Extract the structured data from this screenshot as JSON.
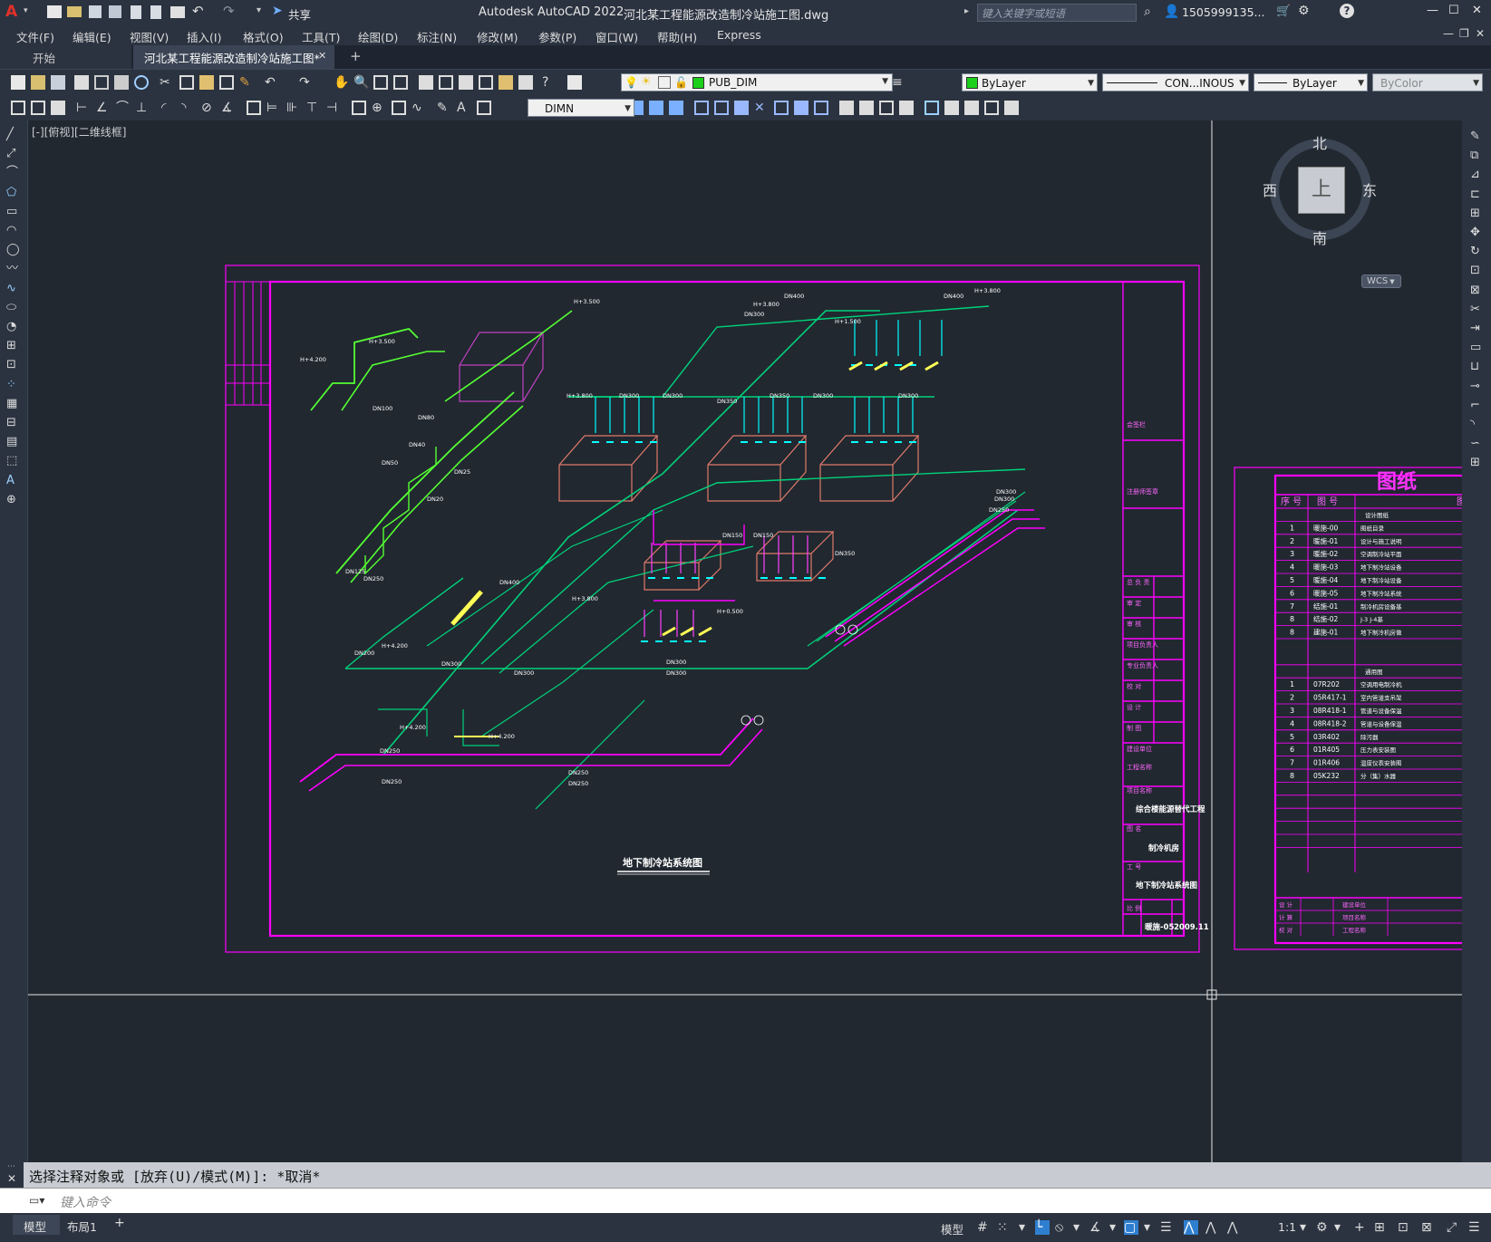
{
  "titlebar": {
    "app_title": "Autodesk AutoCAD 2022",
    "file_name": "河北某工程能源改造制冷站施工图.dwg",
    "share_label": "共享",
    "search_placeholder": "键入关键字或短语",
    "user": "1505999135...",
    "min": "—",
    "max": "☐",
    "close": "✕"
  },
  "menu": [
    "文件(F)",
    "编辑(E)",
    "视图(V)",
    "插入(I)",
    "格式(O)",
    "工具(T)",
    "绘图(D)",
    "标注(N)",
    "修改(M)",
    "参数(P)",
    "窗口(W)",
    "帮助(H)",
    "Express"
  ],
  "tabs": {
    "start": "开始",
    "active": "河北某工程能源改造制冷站施工图*",
    "close": "✕",
    "add": "+"
  },
  "toolbar": {
    "layer": "PUB_DIM",
    "color": "ByLayer",
    "linetype": "CON...INOUS",
    "lineweight": "ByLayer",
    "plotstyle": "ByColor",
    "dimstyle": "DIMN"
  },
  "viewport": {
    "label": "[-][俯视][二维线框]"
  },
  "viewcube": {
    "north": "北",
    "south": "南",
    "east": "东",
    "west": "西",
    "top": "上",
    "wcs": "WCS"
  },
  "drawing": {
    "title": "地下制冷站系统图",
    "project_name": "综合楼能源替代工程",
    "item_name": "制冷机房",
    "sheet_name": "地下制冷站系统图",
    "sheet_no": "暖施-05",
    "date": "2009.11",
    "titleblock_fields": [
      "会签栏",
      "注册师签章",
      "总 负 责",
      "审  定",
      "审  核",
      "项目负责人",
      "专业负责人",
      "校  对",
      "设  计",
      "制  图",
      "建设单位",
      "工程名称",
      "项目名称",
      "图  名",
      "工  号",
      "比  例"
    ],
    "pipe_labels": [
      "DN400",
      "DN300",
      "DN350",
      "DN250",
      "DN200",
      "DN150",
      "DN125",
      "DN100",
      "DN80",
      "DN50",
      "DN40",
      "DN25",
      "DN20",
      "H+3.800",
      "H+1.500",
      "H+0.500",
      "H+4.200",
      "H+3.500"
    ]
  },
  "sheetlist": {
    "title": "图纸",
    "col_no": "序 号",
    "col_code": "图 号",
    "col_name": "图",
    "section1": "设计图纸",
    "section2": "通用图",
    "rows1": [
      {
        "no": "1",
        "code": "暖施-00",
        "name": "图纸目录"
      },
      {
        "no": "2",
        "code": "暖施-01",
        "name": "设计与施工说明"
      },
      {
        "no": "3",
        "code": "暖施-02",
        "name": "空调制冷站平面"
      },
      {
        "no": "4",
        "code": "暖施-03",
        "name": "地下制冷站设备"
      },
      {
        "no": "5",
        "code": "暖施-04",
        "name": "地下制冷站设备"
      },
      {
        "no": "6",
        "code": "暖施-05",
        "name": "地下制冷站系统"
      },
      {
        "no": "7",
        "code": "结施-01",
        "name": "制冷机房设备基"
      },
      {
        "no": "8",
        "code": "结施-02",
        "name": "J-3 J-4基"
      },
      {
        "no": "8",
        "code": "建施-01",
        "name": "地下制冷机房做"
      }
    ],
    "rows2": [
      {
        "no": "1",
        "code": "07R202",
        "name": "空调用电制冷机"
      },
      {
        "no": "2",
        "code": "05R417-1",
        "name": "室内管道支吊架"
      },
      {
        "no": "3",
        "code": "08R418-1",
        "name": "管道与设备保温"
      },
      {
        "no": "4",
        "code": "08R418-2",
        "name": "管道与设备保温"
      },
      {
        "no": "5",
        "code": "03R402",
        "name": "除污器"
      },
      {
        "no": "6",
        "code": "01R405",
        "name": "压力表安装图"
      },
      {
        "no": "7",
        "code": "01R406",
        "name": "温度仪表安装图"
      },
      {
        "no": "8",
        "code": "05K232",
        "name": "分（集）水器"
      }
    ],
    "footer": [
      "设 计",
      "计 算",
      "校 对",
      "建设单位",
      "项目名称",
      "工程名称"
    ]
  },
  "command": {
    "history": "选择注释对象或 [放弃(U)/模式(M)]: *取消*",
    "placeholder": "键入命令"
  },
  "layout_tabs": [
    "模型",
    "布局1",
    "+"
  ],
  "status": {
    "model": "模型",
    "scale": "1:1"
  },
  "colors": {
    "magenta": "#ff00ff",
    "cyan": "#00ffff",
    "green": "#00d27a",
    "lime": "#55ff33",
    "salmon": "#e07a6a",
    "yellow": "#ffff55"
  }
}
